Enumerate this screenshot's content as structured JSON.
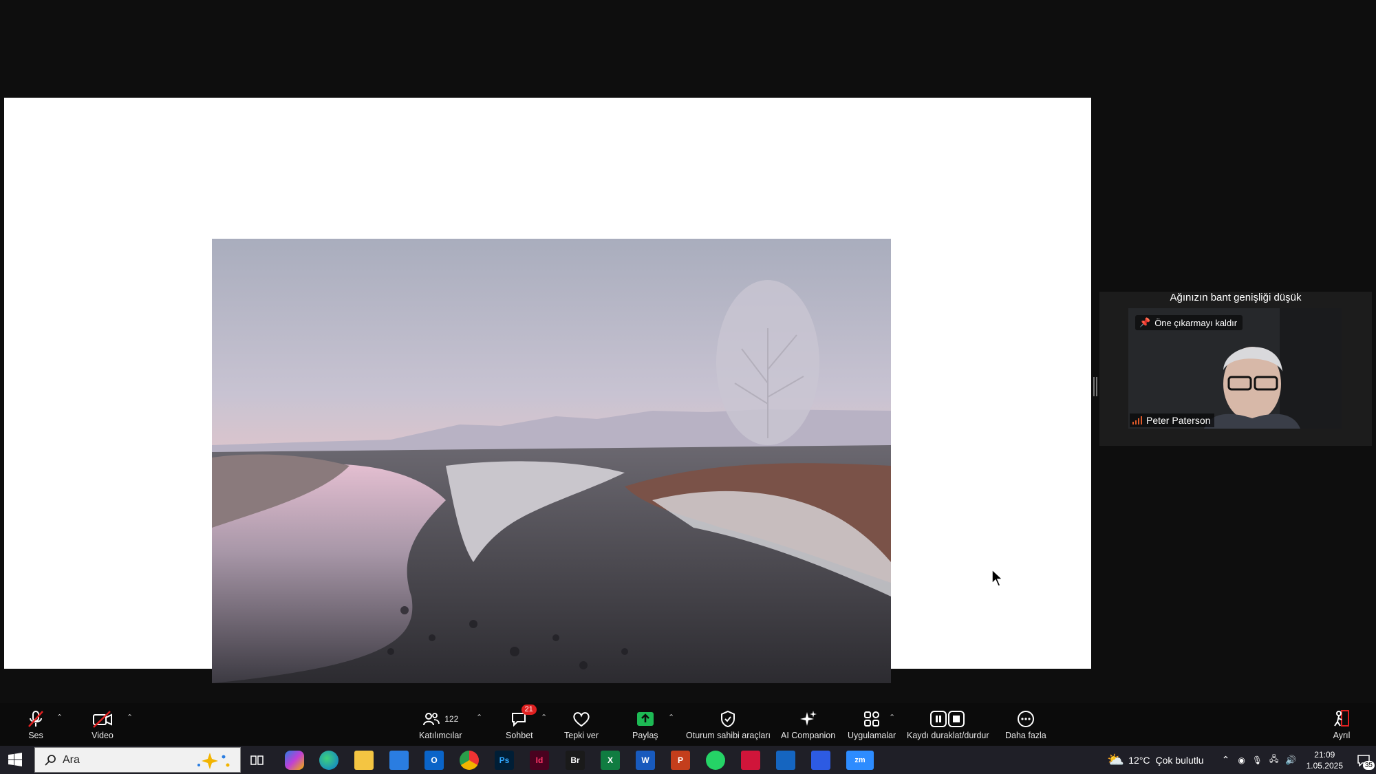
{
  "panel": {
    "bandwidth_warning": "Ağınızın bant genişliği düşük",
    "unpin_label": "Öne çıkarmayı kaldır",
    "participant_name": "Peter Paterson"
  },
  "toolbar": {
    "audio_label": "Ses",
    "video_label": "Video",
    "participants_label": "Katılımcılar",
    "participants_count": "122",
    "chat_label": "Sohbet",
    "chat_badge": "21",
    "react_label": "Tepki ver",
    "share_label": "Paylaş",
    "host_tools_label": "Oturum sahibi araçları",
    "ai_label": "AI Companion",
    "apps_label": "Uygulamalar",
    "record_label": "Kaydı duraklat/durdur",
    "more_label": "Daha fazla",
    "leave_label": "Ayrıl"
  },
  "taskbar": {
    "search_placeholder": "Ara",
    "apps": [
      "task-view",
      "copilot",
      "edge",
      "file-explorer",
      "store",
      "outlook",
      "chrome",
      "photoshop",
      "indesign",
      "bridge",
      "excel",
      "word",
      "powerpoint",
      "whatsapp",
      "app-red",
      "app-blue",
      "app-blue2",
      "zoom"
    ],
    "weather_temp": "12°C",
    "weather_text": "Çok bulutlu",
    "time": "21:09",
    "date": "1.05.2025",
    "notification_count": "35"
  },
  "colors": {
    "toolbar_bg": "#0b0b0b",
    "share_green": "#1db954",
    "muted_red": "#e02020",
    "taskbar_bg": "#1f1f27"
  }
}
